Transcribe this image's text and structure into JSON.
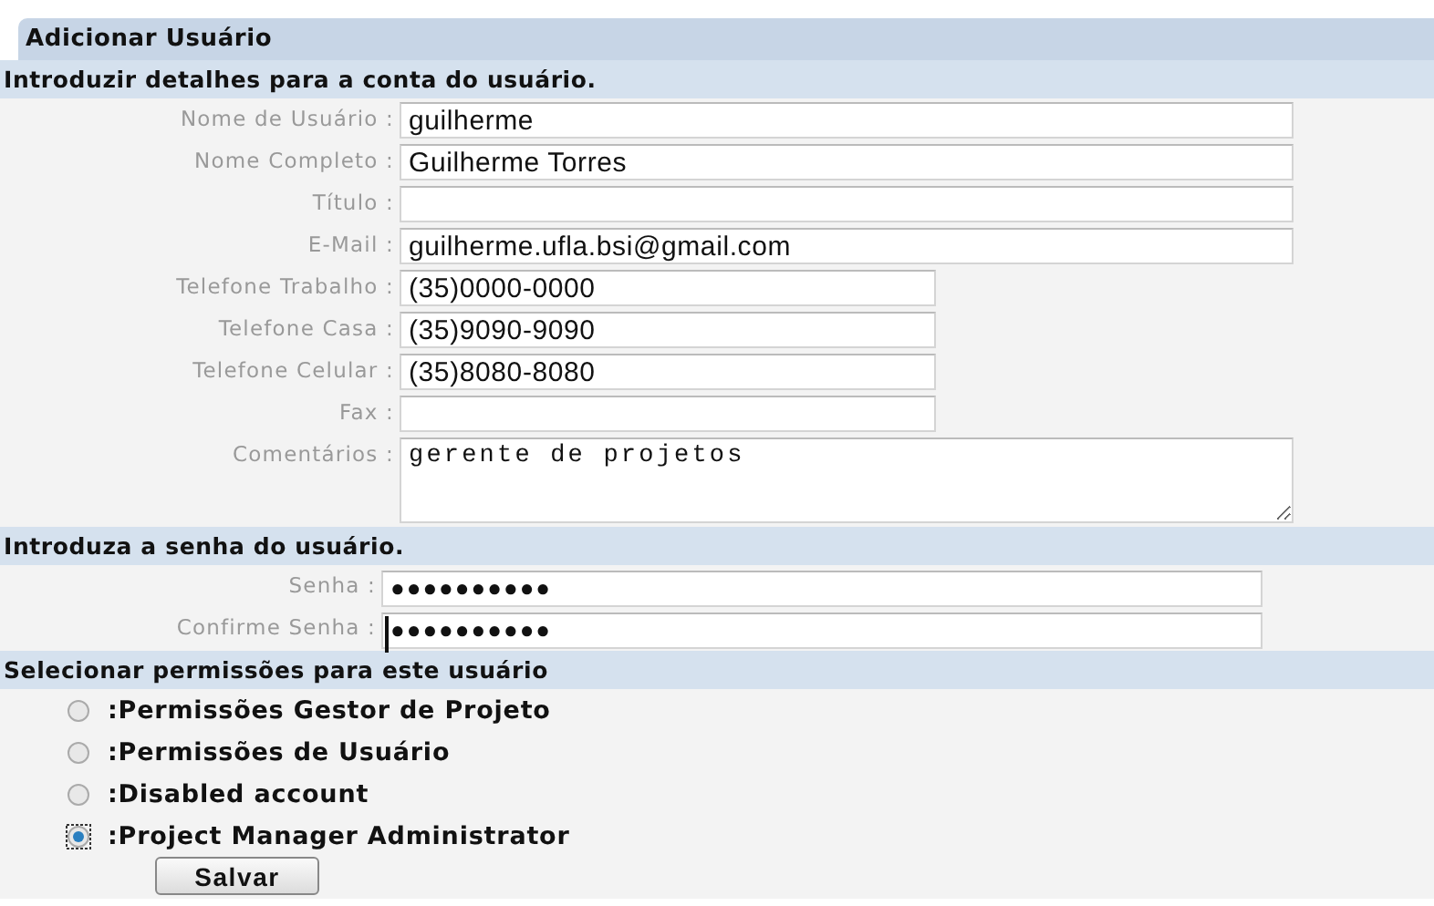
{
  "panel": {
    "title": "Adicionar Usuário"
  },
  "sections": [
    {
      "title": "Introduzir detalhes para a conta do usuário.",
      "kind": "fields",
      "fields": [
        {
          "label": "Nome de Usuário :",
          "kind": "text",
          "wide": true,
          "value": "guilherme"
        },
        {
          "label": "Nome Completo :",
          "kind": "text",
          "wide": true,
          "value": "Guilherme Torres"
        },
        {
          "label": "Título :",
          "kind": "text",
          "wide": true
        },
        {
          "label": "E-Mail :",
          "kind": "text",
          "wide": true,
          "value": "guilherme.ufla.bsi@gmail.com"
        },
        {
          "label": "Telefone Trabalho :",
          "kind": "text",
          "wide": false,
          "value": "(35)0000-0000"
        },
        {
          "label": "Telefone Casa :",
          "kind": "text",
          "wide": false,
          "value": "(35)9090-9090"
        },
        {
          "label": "Telefone Celular :",
          "kind": "text",
          "wide": false,
          "value": "(35)8080-8080"
        },
        {
          "label": "Fax :",
          "kind": "text",
          "wide": false
        },
        {
          "label": "Comentários :",
          "kind": "textarea",
          "value": "gerente de projetos"
        }
      ]
    },
    {
      "title": "Introduza a senha do usuário.",
      "kind": "fields",
      "fields": [
        {
          "label": "Senha :",
          "kind": "password",
          "value": "●●●●●●●●●●"
        },
        {
          "label": "Confirme Senha :",
          "kind": "password",
          "value": "●●●●●●●●●●",
          "focused": true
        }
      ]
    },
    {
      "title": "Selecionar permissões para este usuário",
      "kind": "options",
      "options": [
        {
          "label": ":Permissões Gestor de Projeto",
          "selected": false
        },
        {
          "label": ":Permissões de Usuário",
          "selected": false
        },
        {
          "label": ":Disabled account",
          "selected": false
        },
        {
          "label": ":Project Manager Administrator",
          "selected": true
        }
      ]
    }
  ],
  "buttons": [
    {
      "label": "Salvar"
    }
  ]
}
